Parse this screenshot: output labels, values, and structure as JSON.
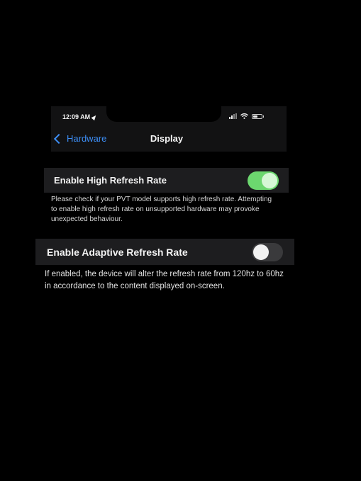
{
  "status_bar": {
    "time": "12:09 AM",
    "icons": [
      "location-arrow-icon",
      "cellular-signal-icon",
      "wifi-icon",
      "battery-icon"
    ],
    "battery_level": 0.5
  },
  "nav": {
    "back_label": "Hardware",
    "title": "Display",
    "back_icon": "chevron-left-icon"
  },
  "settings": [
    {
      "label": "Enable High Refresh Rate",
      "enabled": true,
      "footnote": "Please check if your PVT model supports high refresh rate. Attempting to enable high refresh rate on unsupported hardware may provoke unexpected behaviour."
    },
    {
      "label": "Enable Adaptive Refresh Rate",
      "enabled": false,
      "footnote": "If enabled, the device will alter the refresh rate from 120hz to 60hz in accordance to the content displayed on-screen."
    }
  ],
  "colors": {
    "accent_blue": "#3d8ef5",
    "toggle_on_green": "#6cd76f",
    "toggle_off_gray": "#3a3a3c",
    "cell_background": "#1d1d1f",
    "background": "#000000"
  }
}
